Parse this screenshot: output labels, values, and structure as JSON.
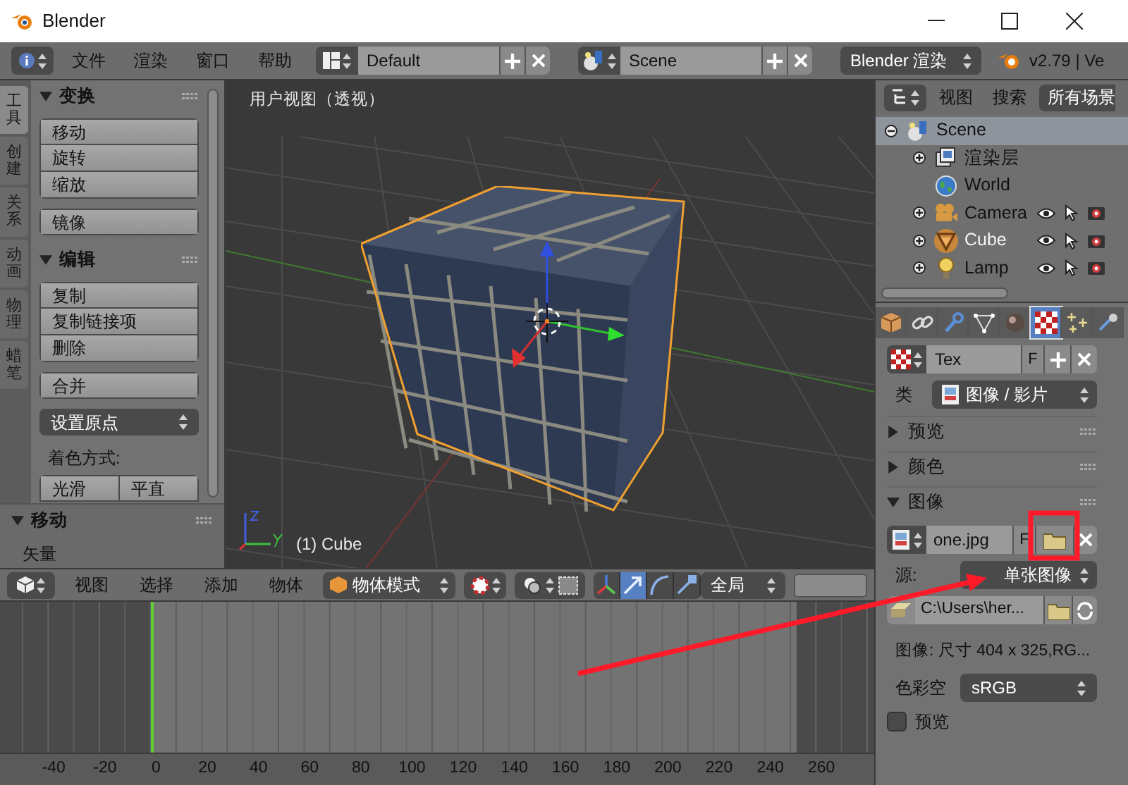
{
  "window": {
    "title": "Blender"
  },
  "top_bar": {
    "menus": [
      "文件",
      "渲染",
      "窗口",
      "帮助"
    ],
    "screen_layout": "Default",
    "scene": "Scene",
    "render_engine": "Blender 渲染",
    "version": "v2.79 | Ve"
  },
  "tool_shelf": {
    "tabs": [
      {
        "label": "工具",
        "selected": true
      },
      {
        "label": "创建",
        "selected": false
      },
      {
        "label": "关系",
        "selected": false
      },
      {
        "label": "动画",
        "selected": false
      },
      {
        "label": "物理",
        "selected": false
      },
      {
        "label": "蜡笔",
        "selected": false
      }
    ],
    "panels": [
      {
        "title": "变换",
        "expanded": true,
        "groups": [
          [
            "移动",
            "旋转",
            "缩放"
          ],
          [
            "镜像"
          ]
        ]
      },
      {
        "title": "编辑",
        "expanded": true,
        "groups": [
          [
            "复制",
            "复制链接项",
            "删除"
          ],
          [
            "合并"
          ]
        ],
        "dropdown": "设置原点",
        "shading_label": "着色方式:",
        "shading_buttons": [
          "光滑",
          "平直"
        ]
      }
    ]
  },
  "operator_panel": {
    "title": "移动",
    "expanded": true,
    "field_label": "矢量"
  },
  "viewport": {
    "view_label": "用户视图（透视）",
    "object_label": "(1) Cube"
  },
  "viewport_header": {
    "menus": [
      "视图",
      "选择",
      "添加",
      "物体"
    ],
    "mode": "物体模式",
    "manipulators": [
      {
        "kind": "axes",
        "selected": false
      },
      {
        "kind": "translate",
        "selected": true
      },
      {
        "kind": "rotate",
        "selected": false
      },
      {
        "kind": "scale",
        "selected": false
      }
    ],
    "orientation": "全局"
  },
  "timeline": {
    "ticks": [
      "-40",
      "-20",
      "0",
      "20",
      "40",
      "60",
      "80",
      "100",
      "120",
      "140",
      "160",
      "180",
      "200",
      "220",
      "240",
      "260"
    ]
  },
  "outliner": {
    "menus": [
      "视图",
      "搜索"
    ],
    "filter": "所有场景",
    "tree": [
      {
        "name": "Scene",
        "kind": "scene",
        "expanded": true,
        "active": true,
        "children": [
          {
            "name": "渲染层",
            "kind": "render_layers",
            "expanded": false,
            "selected": false
          },
          {
            "name": "World",
            "kind": "world",
            "selected": false
          },
          {
            "name": "Camera",
            "kind": "camera",
            "expanded": false,
            "selected": false
          },
          {
            "name": "Cube",
            "kind": "mesh",
            "expanded": false,
            "selected": true
          },
          {
            "name": "Lamp",
            "kind": "lamp",
            "expanded": false,
            "selected": false
          }
        ]
      }
    ]
  },
  "properties": {
    "tabs": [
      {
        "kind": "object",
        "selected": false
      },
      {
        "kind": "constraints",
        "selected": false
      },
      {
        "kind": "modifiers",
        "selected": false
      },
      {
        "kind": "data",
        "selected": false
      },
      {
        "kind": "material",
        "selected": false
      },
      {
        "kind": "texture",
        "selected": true
      },
      {
        "kind": "particles",
        "selected": false
      },
      {
        "kind": "physics",
        "selected": false
      }
    ],
    "texture": {
      "name": "Tex",
      "fake_user": "F",
      "type_label": "类",
      "type": "图像 / 影片"
    },
    "panels": [
      {
        "title": "预览",
        "expanded": false
      },
      {
        "title": "颜色",
        "expanded": false
      },
      {
        "title": "图像",
        "expanded": true
      }
    ],
    "image": {
      "name": "one.jpg",
      "fake_user": "F",
      "source_label": "源:",
      "source": "单张图像",
      "path": "C:\\Users\\her...",
      "info": "图像: 尺寸 404 x 325,RG...",
      "colorspace_label": "色彩空",
      "colorspace": "sRGB",
      "preview": {
        "label": "预览",
        "checked": false
      }
    }
  }
}
